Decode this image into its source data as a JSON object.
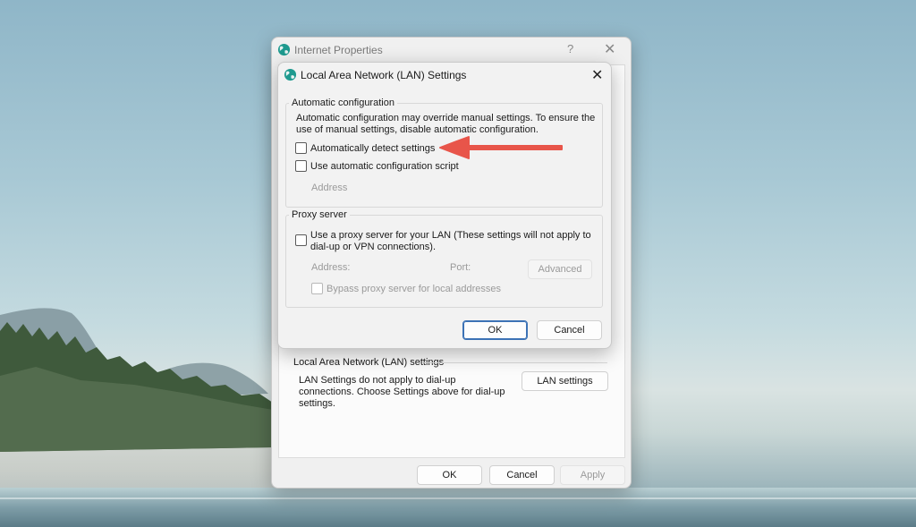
{
  "parent": {
    "title": "Internet Properties",
    "help_glyph": "?",
    "close_glyph": "✕",
    "lan_section": {
      "heading": "Local Area Network (LAN) settings",
      "note": "LAN Settings do not apply to dial-up connections. Choose Settings above for dial-up settings.",
      "lan_button": "LAN settings"
    },
    "buttons": {
      "ok": "OK",
      "cancel": "Cancel",
      "apply": "Apply"
    }
  },
  "lan_dialog": {
    "title": "Local Area Network (LAN) Settings",
    "close_glyph": "✕",
    "auto_config": {
      "heading": "Automatic configuration",
      "description": "Automatic configuration may override manual settings.  To ensure the use of manual settings, disable automatic configuration.",
      "auto_detect": {
        "label": "Automatically detect settings",
        "checked": false
      },
      "auto_script": {
        "label": "Use automatic configuration script",
        "checked": false
      },
      "address_label": "Address"
    },
    "proxy": {
      "heading": "Proxy server",
      "use_proxy": {
        "label": "Use a proxy server for your LAN (These settings will not apply to dial-up or VPN connections).",
        "checked": false
      },
      "address_label": "Address:",
      "port_label": "Port:",
      "advanced_button": "Advanced",
      "bypass": {
        "label": "Bypass proxy server for local addresses",
        "checked": false
      }
    },
    "buttons": {
      "ok": "OK",
      "cancel": "Cancel"
    }
  },
  "annotation": {
    "arrow_color": "#e8554a",
    "points_to": "Automatically detect settings"
  },
  "colors": {
    "accent": "#3c72b5",
    "globe": "#1e9a8f"
  },
  "icons": {
    "title_icon": "globe-icon"
  }
}
